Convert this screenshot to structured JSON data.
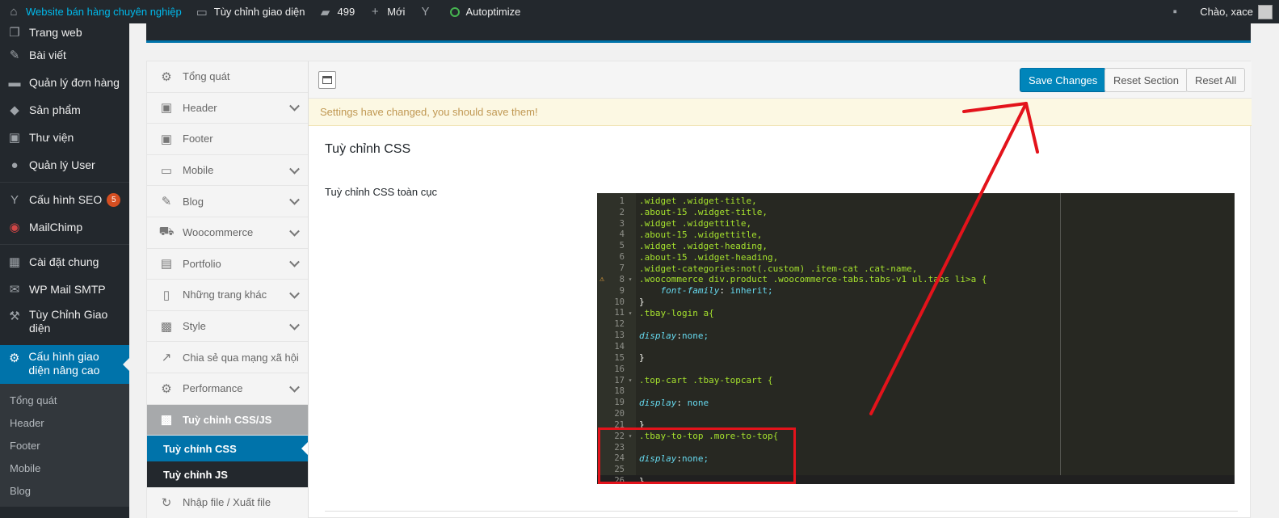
{
  "adminbar": {
    "site_name": "Website bán hàng chuyên nghiệp",
    "customize": "Tùy chỉnh giao diện",
    "comments_count": "499",
    "new": "Mới",
    "autoptimize": "Autoptimize",
    "greeting": "Chào, xace"
  },
  "menu": {
    "items": [
      {
        "label": "Trang web",
        "icon": "pages-icon"
      },
      {
        "label": "Bài viết",
        "icon": "pin-icon"
      },
      {
        "label": "Quản lý đơn hàng",
        "icon": "woo-icon"
      },
      {
        "label": "Sản phẩm",
        "icon": "cube-icon"
      },
      {
        "label": "Thư viện",
        "icon": "media-icon"
      },
      {
        "label": "Quản lý User",
        "icon": "user-icon"
      },
      {
        "label": "Cấu hình SEO",
        "icon": "yoast-icon",
        "badge": "5"
      },
      {
        "label": "MailChimp",
        "icon": "mailchimp-icon"
      },
      {
        "label": "Cài đặt chung",
        "icon": "settings-icon"
      },
      {
        "label": "WP Mail SMTP",
        "icon": "mail-icon"
      },
      {
        "label": "Tùy Chỉnh Giao diện",
        "icon": "tools-icon"
      },
      {
        "label": "Cấu hình giao diện nâng cao",
        "icon": "gear-icon"
      }
    ],
    "submenu": [
      "Tổng quát",
      "Header",
      "Footer",
      "Mobile",
      "Blog"
    ]
  },
  "options_sidebar": {
    "items": [
      "Tổng quát",
      "Header",
      "Footer",
      "Mobile",
      "Blog",
      "Woocommerce",
      "Portfolio",
      "Những trang khác",
      "Style",
      "Chia sẻ qua mạng xã hội",
      "Performance",
      "Tuỳ chỉnh CSS/JS"
    ],
    "subitems": [
      "Tuỳ chỉnh CSS",
      "Tuỳ chỉnh JS"
    ],
    "last": "Nhập file / Xuất file"
  },
  "toolbar": {
    "save": "Save Changes",
    "reset_section": "Reset Section",
    "reset_all": "Reset All"
  },
  "notice": "Settings have changed, you should save them!",
  "section_title": "Tuỳ chỉnh CSS",
  "field_label": "Tuỳ chỉnh CSS toàn cục",
  "code_lines": [
    ".widget .widget-title,",
    ".about-15 .widget-title,",
    ".widget .widgettitle,",
    ".about-15 .widgettitle,",
    ".widget .widget-heading,",
    ".about-15 .widget-heading,",
    ".widget-categories:not(.custom) .item-cat .cat-name,",
    ".woocommerce div.product .woocommerce-tabs.tabs-v1 ul.tabs li>a {",
    "    font-family: inherit;",
    "}",
    ".tbay-login a{",
    "",
    "display:none;",
    "",
    "}",
    "",
    ".top-cart .tbay-topcart {",
    "",
    "display: none",
    "",
    "}",
    ".tbay-to-top .more-to-top{",
    "",
    "display:none;",
    "",
    "}"
  ],
  "colors": {
    "accent": "#0073aa",
    "annotation": "#e3131b"
  }
}
